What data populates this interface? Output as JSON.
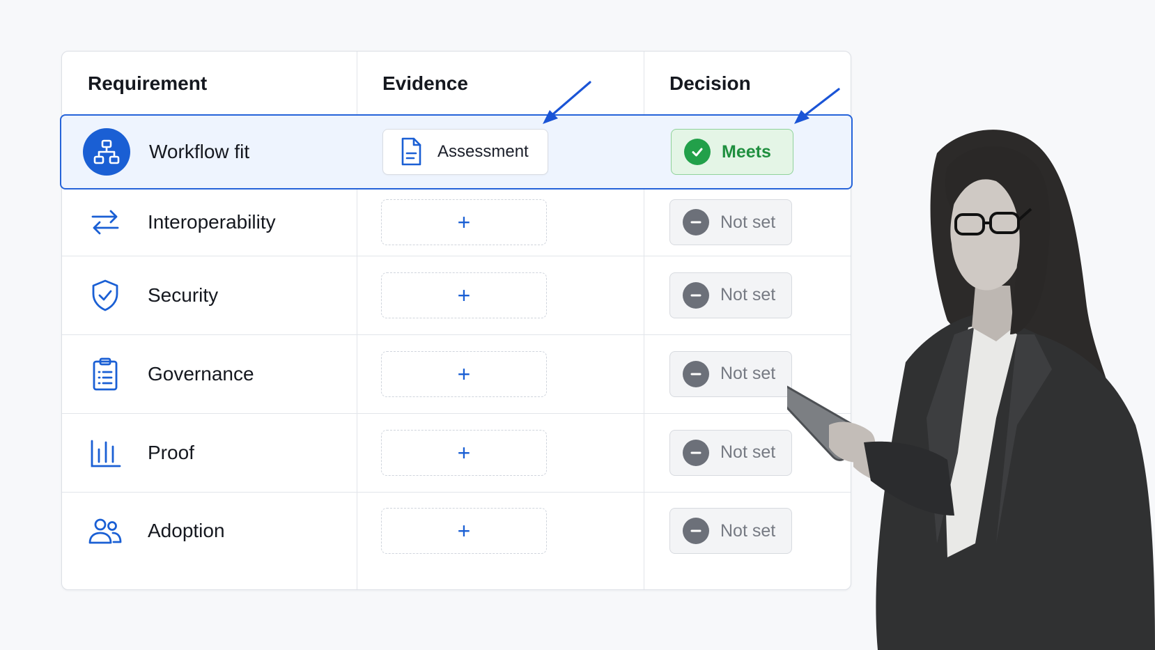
{
  "table": {
    "headers": {
      "requirement": "Requirement",
      "evidence": "Evidence",
      "decision": "Decision"
    },
    "rows": [
      {
        "label": "Workflow fit",
        "icon": "workflow-icon",
        "evidence": "Assessment",
        "evidence_state": "filled",
        "decision": "Meets",
        "decision_state": "meets",
        "selected": true
      },
      {
        "label": "Interoperability",
        "icon": "swap-arrows-icon",
        "evidence": "+",
        "evidence_state": "empty",
        "decision": "Not set",
        "decision_state": "notset"
      },
      {
        "label": "Security",
        "icon": "shield-check-icon",
        "evidence": "+",
        "evidence_state": "empty",
        "decision": "Not set",
        "decision_state": "notset"
      },
      {
        "label": "Governance",
        "icon": "clipboard-list-icon",
        "evidence": "+",
        "evidence_state": "empty",
        "decision": "Not set",
        "decision_state": "notset"
      },
      {
        "label": "Proof",
        "icon": "bar-chart-icon",
        "evidence": "+",
        "evidence_state": "empty",
        "decision": "Not set",
        "decision_state": "notset"
      },
      {
        "label": "Adoption",
        "icon": "users-icon",
        "evidence": "+",
        "evidence_state": "empty",
        "decision": "Not set",
        "decision_state": "notset"
      }
    ]
  },
  "colors": {
    "accent": "#1a5fd4",
    "meets_green": "#22a04a",
    "notset_gray": "#6c7079",
    "selected_row_bg": "#eef4fe"
  }
}
